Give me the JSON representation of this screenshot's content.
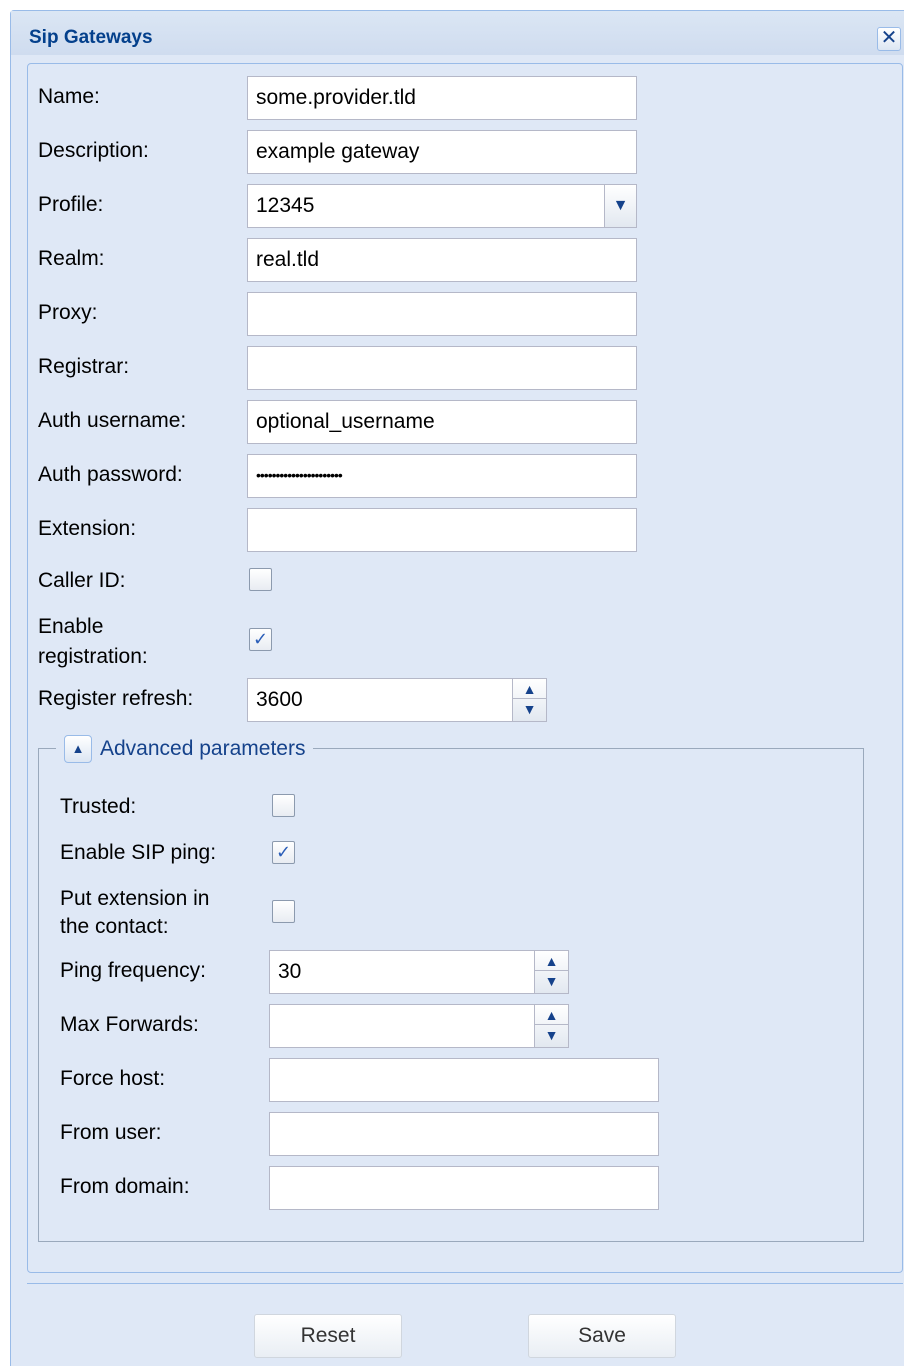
{
  "window": {
    "title": "Sip Gateways",
    "close_icon": "close-icon"
  },
  "form": {
    "name": {
      "label": "Name:",
      "value": "some.provider.tld"
    },
    "description": {
      "label": "Description:",
      "value": "example gateway"
    },
    "profile": {
      "label": "Profile:",
      "value": "12345"
    },
    "realm": {
      "label": "Realm:",
      "value": "real.tld"
    },
    "proxy": {
      "label": "Proxy:",
      "value": ""
    },
    "registrar": {
      "label": "Registrar:",
      "value": ""
    },
    "auth_username": {
      "label": "Auth username:",
      "value": "optional_username"
    },
    "auth_password": {
      "label": "Auth password:",
      "value": "••••••••••••••••••••••"
    },
    "extension": {
      "label": "Extension:",
      "value": ""
    },
    "caller_id": {
      "label": "Caller ID:",
      "checked": false
    },
    "enable_registration": {
      "label_line1": "Enable",
      "label_line2": "registration:",
      "checked": true
    },
    "register_refresh": {
      "label": "Register refresh:",
      "value": "3600"
    }
  },
  "advanced": {
    "legend": "Advanced parameters",
    "expanded": true,
    "trusted": {
      "label": "Trusted:",
      "checked": false
    },
    "enable_sip_ping": {
      "label": "Enable SIP ping:",
      "checked": true
    },
    "put_extension": {
      "label_line1": "Put extension in",
      "label_line2": "the contact:",
      "checked": false
    },
    "ping_frequency": {
      "label": "Ping frequency:",
      "value": "30"
    },
    "max_forwards": {
      "label": "Max Forwards:",
      "value": ""
    },
    "force_host": {
      "label": "Force host:",
      "value": ""
    },
    "from_user": {
      "label": "From user:",
      "value": ""
    },
    "from_domain": {
      "label": "From domain:",
      "value": ""
    }
  },
  "buttons": {
    "reset": "Reset",
    "save": "Save"
  },
  "colors": {
    "panel_bg": "#dfe8f6",
    "title_text": "#04408c",
    "border": "#99bbe8",
    "legend_text": "#15428b"
  }
}
